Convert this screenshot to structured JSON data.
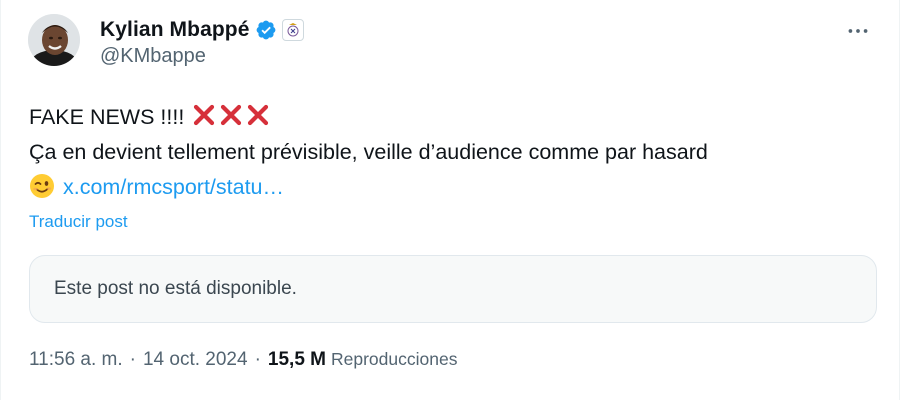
{
  "author": {
    "display_name": "Kylian Mbappé",
    "handle": "@KMbappe"
  },
  "tweet": {
    "line1_text": "FAKE NEWS !!!!",
    "line2_text": "Ça en devient tellement prévisible, veille d’audience comme par hasard",
    "link_text": "x.com/rmcsport/statu…",
    "emoji_names": [
      "cross-mark",
      "cross-mark",
      "cross-mark",
      "winking-face"
    ]
  },
  "translate_label": "Traducir post",
  "quote": {
    "text": "Este post no está disponible."
  },
  "meta": {
    "time": "11:56 a. m.",
    "separator": "·",
    "date": "14 oct. 2024",
    "views_count": "15,5 M",
    "views_label": "Reproducciones"
  },
  "colors": {
    "link": "#1d9bf0",
    "verified": "#1d9bf0",
    "cross": "#d6303a",
    "secondary_text": "#536471"
  },
  "icons": {
    "verified": "verified-badge-icon",
    "affiliate": "real-madrid-crest-icon",
    "more": "more-dots-icon"
  }
}
